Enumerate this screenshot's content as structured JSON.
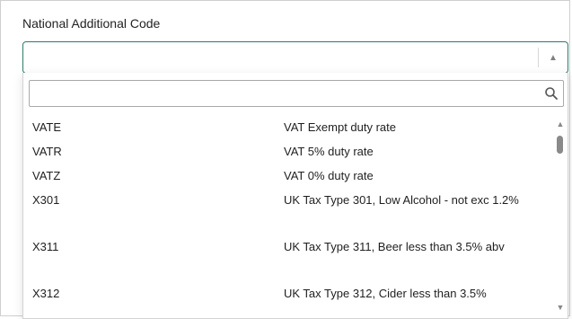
{
  "field": {
    "label": "National Additional Code",
    "selected_value": ""
  },
  "search": {
    "value": "",
    "placeholder": ""
  },
  "icons": {
    "search": "search-icon",
    "dropdown_toggle": "caret-up-icon",
    "scroll_up": "caret-up-icon",
    "scroll_down": "caret-down-icon"
  },
  "options": [
    {
      "code": "VATE",
      "description": "VAT Exempt duty rate"
    },
    {
      "code": "VATR",
      "description": "VAT 5% duty rate"
    },
    {
      "code": "VATZ",
      "description": "VAT 0% duty rate"
    },
    {
      "code": "X301",
      "description": "UK Tax Type 301, Low Alcohol - not exc 1.2%"
    },
    {
      "code": "X311",
      "description": "UK Tax Type 311, Beer less than 3.5% abv"
    },
    {
      "code": "X312",
      "description": "UK Tax Type 312, Cider less than 3.5%"
    }
  ],
  "scroll_position": 0.05,
  "colors": {
    "focus_border": "#2f7a70",
    "text": "#1f1f1f",
    "muted": "#808080"
  }
}
